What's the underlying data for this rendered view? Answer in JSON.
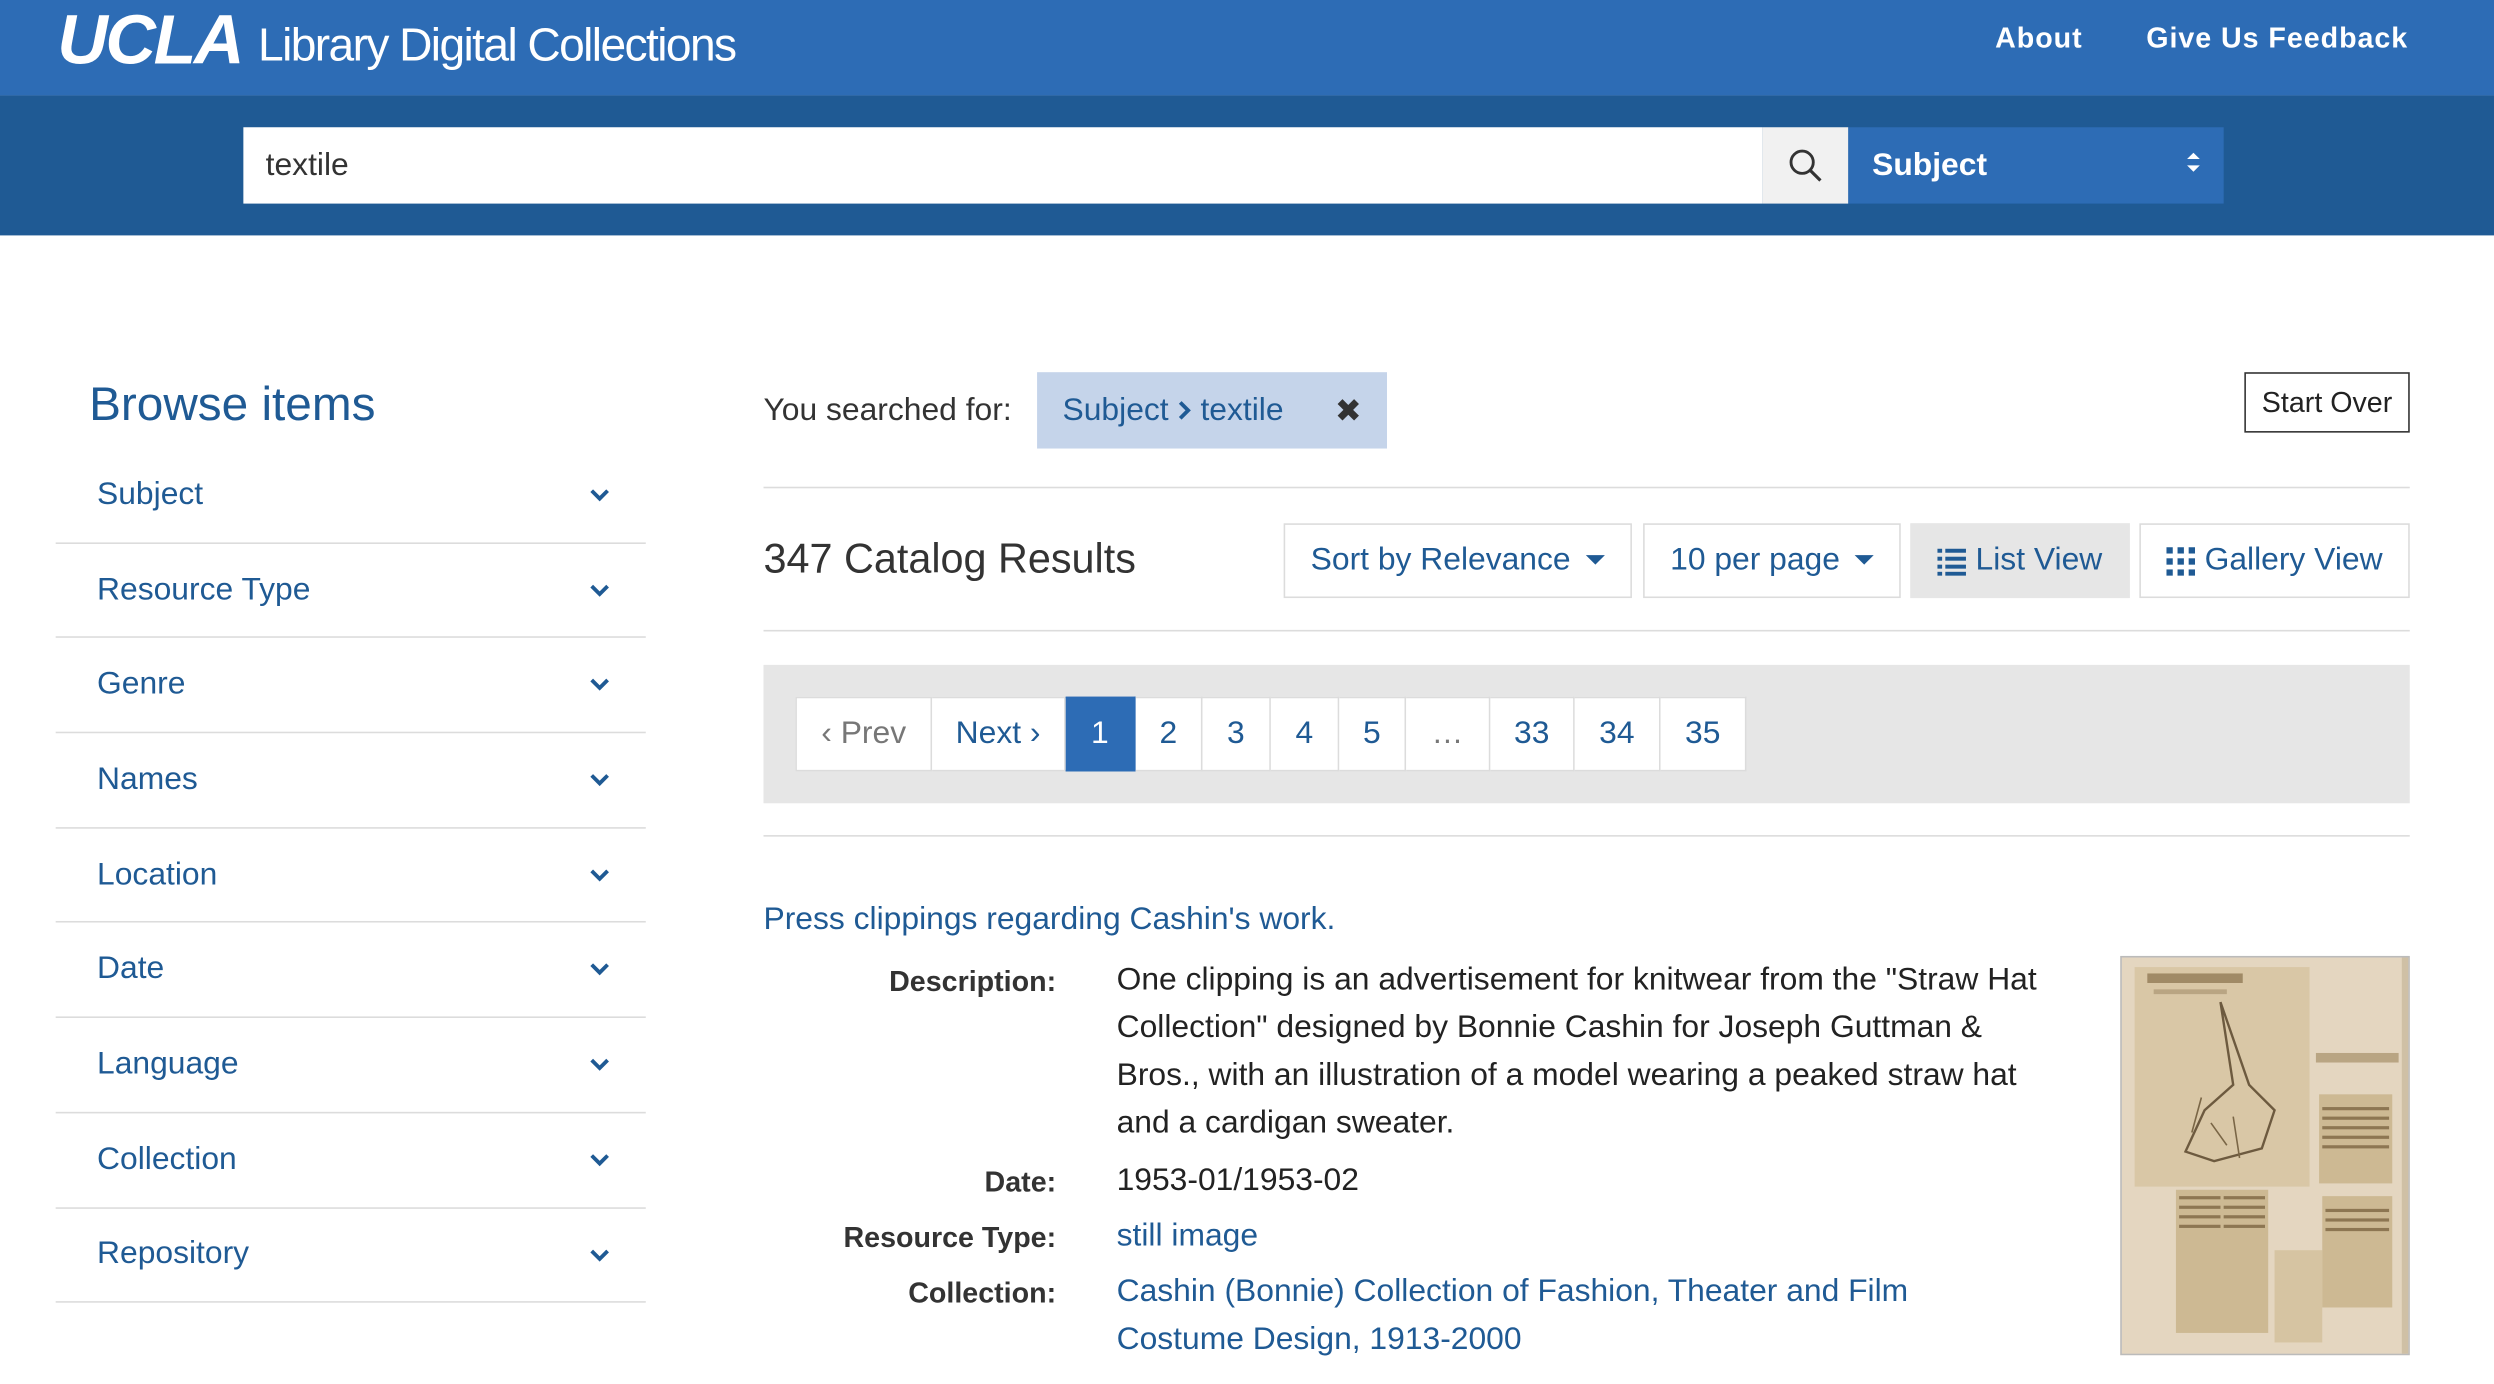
{
  "header": {
    "brand_ucla": "UCLA",
    "brand_rest": "Library Digital Collections",
    "nav": [
      "About",
      "Give Us Feedback"
    ]
  },
  "search": {
    "query": "textile",
    "field": "Subject"
  },
  "sidebar": {
    "title": "Browse items",
    "facets": [
      "Subject",
      "Resource Type",
      "Genre",
      "Names",
      "Location",
      "Date",
      "Language",
      "Collection",
      "Repository"
    ]
  },
  "constraints": {
    "label": "You searched for:",
    "field": "Subject",
    "value": "textile",
    "remove_glyph": "✖",
    "start_over": "Start Over"
  },
  "results": {
    "count_text": "347 Catalog Results",
    "sort_label": "Sort by Relevance",
    "per_page_label": "10 per page",
    "list_view_label": "List View",
    "gallery_view_label": "Gallery View"
  },
  "pagination": {
    "prev": "‹ Prev",
    "next": "Next ›",
    "pages": [
      "1",
      "2",
      "3",
      "4",
      "5",
      "…",
      "33",
      "34",
      "35"
    ],
    "current": "1"
  },
  "document": {
    "title": "Press clippings regarding Cashin's work.",
    "labels": {
      "description": "Description:",
      "date": "Date:",
      "resource_type": "Resource Type:",
      "collection": "Collection:"
    },
    "description_lines": [
      "One clipping is an advertisement for knitwear from the \"Straw Hat",
      "Collection\" designed by Bonnie Cashin for Joseph Guttman &",
      "Bros., with an illustration of a model wearing a peaked straw hat",
      "and a cardigan sweater."
    ],
    "date": "1953-01/1953-02",
    "resource_type": "still image",
    "collection_lines": [
      "Cashin (Bonnie) Collection of Fashion, Theater and Film",
      "Costume Design, 1913-2000"
    ]
  },
  "colors": {
    "topbar": "#2d6cb5",
    "searchband": "#1f5a94",
    "link": "#1f5a94"
  }
}
